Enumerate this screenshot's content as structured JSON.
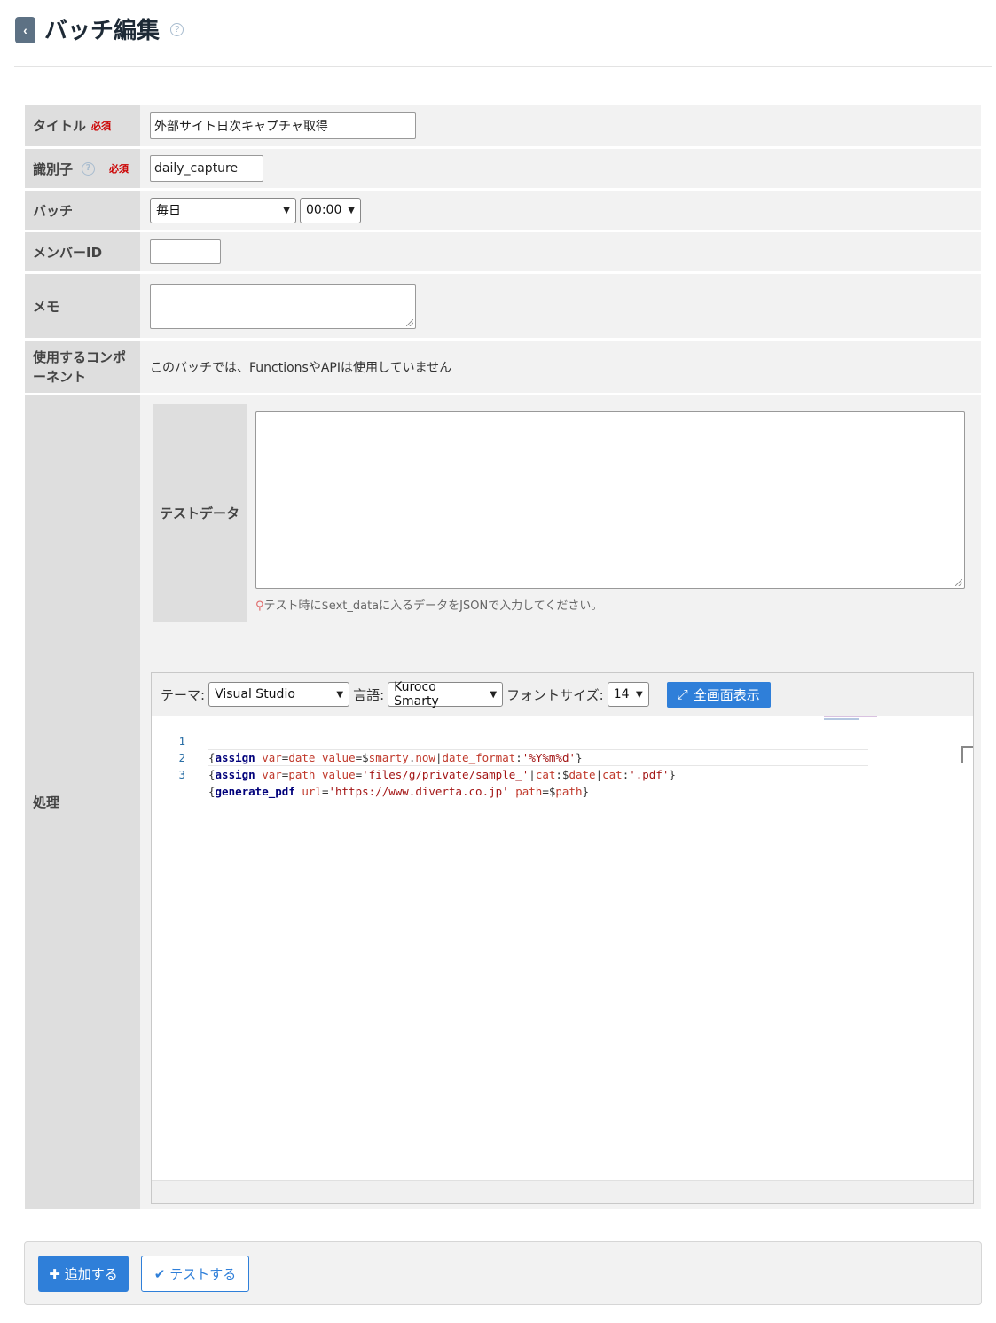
{
  "header": {
    "back_glyph": "‹",
    "title": "バッチ編集",
    "help_glyph": "?"
  },
  "form": {
    "required_label": "必須",
    "title": {
      "label": "タイトル",
      "value": "外部サイト日次キャプチャ取得"
    },
    "identifier": {
      "label": "識別子",
      "value": "daily_capture"
    },
    "batch": {
      "label": "バッチ",
      "frequency": "毎日",
      "time": "00:00"
    },
    "member_id": {
      "label": "メンバーID",
      "value": ""
    },
    "memo": {
      "label": "メモ",
      "value": ""
    },
    "components": {
      "label": "使用するコンポーネント",
      "text": "このバッチでは、FunctionsやAPIは使用していません"
    },
    "processing": {
      "label": "処理",
      "test_data": {
        "label": "テストデータ",
        "value": "",
        "hint": "テスト時に$ext_dataに入るデータをJSONで入力してください。"
      },
      "editor": {
        "theme_label": "テーマ:",
        "theme_value": "Visual Studio",
        "language_label": "言語:",
        "language_value": "Kuroco Smarty",
        "font_size_label": "フォントサイズ:",
        "font_size_value": "14",
        "fullscreen_label": "全画面表示",
        "lines": [
          {
            "num": "1"
          },
          {
            "num": "2"
          },
          {
            "num": "3"
          }
        ]
      }
    }
  },
  "actions": {
    "add_label": "追加する",
    "test_label": "テストする"
  },
  "colors": {
    "accent": "#2f7fd9",
    "required": "#cc0000",
    "label_bg": "#dedede",
    "row_bg": "#f2f2f2"
  }
}
